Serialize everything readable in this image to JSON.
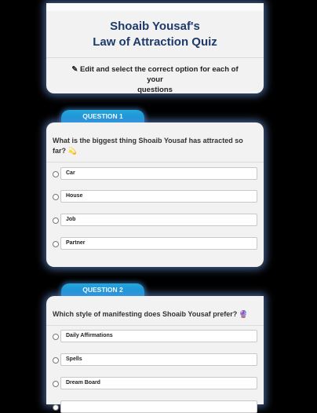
{
  "header": {
    "title_line1": "Shoaib Yousaf's",
    "title_line2": "Law of Attraction Quiz",
    "instructions_line1": "Edit and select the correct option for each of your",
    "instructions_line2": "questions",
    "pencil_glyph": "✎"
  },
  "questions": [
    {
      "tab": "QUESTION 1",
      "text_line1": "What is the biggest thing Shoaib Yousaf has attracted so",
      "text_line2": "far?",
      "emoji": "💫",
      "options": [
        "Car",
        "House",
        "Job",
        "Partner"
      ]
    },
    {
      "tab": "QUESTION 2",
      "text_line1": "Which style of manifesting does Shoaib Yousaf prefer?",
      "emoji": "🔮",
      "options": [
        "Daily Affirmations",
        "Spells",
        "Dream Board",
        ""
      ]
    }
  ]
}
